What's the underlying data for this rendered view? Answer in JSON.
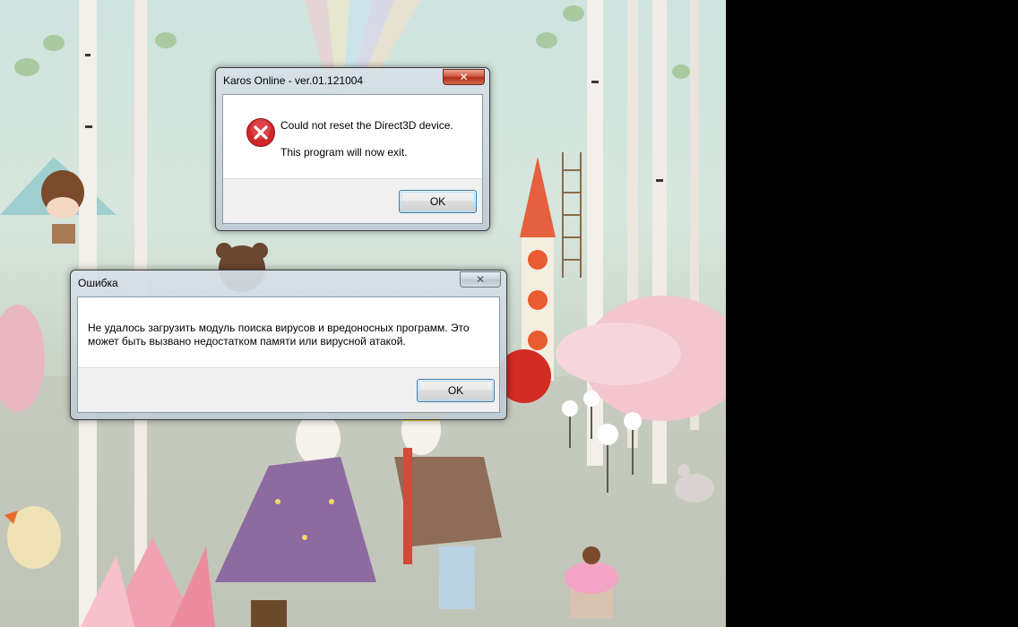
{
  "dialogs": {
    "karos": {
      "title": "Karos Online - ver.01.121004",
      "close_glyph": "✕",
      "line1": "Could not reset the Direct3D device.",
      "line2": "This program will now exit.",
      "ok_label": "OK",
      "icon": "error-x-icon",
      "icon_color": "#d0262a"
    },
    "oshibka": {
      "title": "Ошибка",
      "close_glyph": "✕",
      "line1": "Не удалось загрузить модуль поиска вирусов и вредоносных программ. Это",
      "line2": "может быть вызвано недостатком памяти или вирусной атакой.",
      "ok_label": "OK"
    }
  },
  "colors": {
    "button_focus_border": "#3c7fb1",
    "close_active": "#c7462e",
    "desktop_outside": "#000000"
  }
}
